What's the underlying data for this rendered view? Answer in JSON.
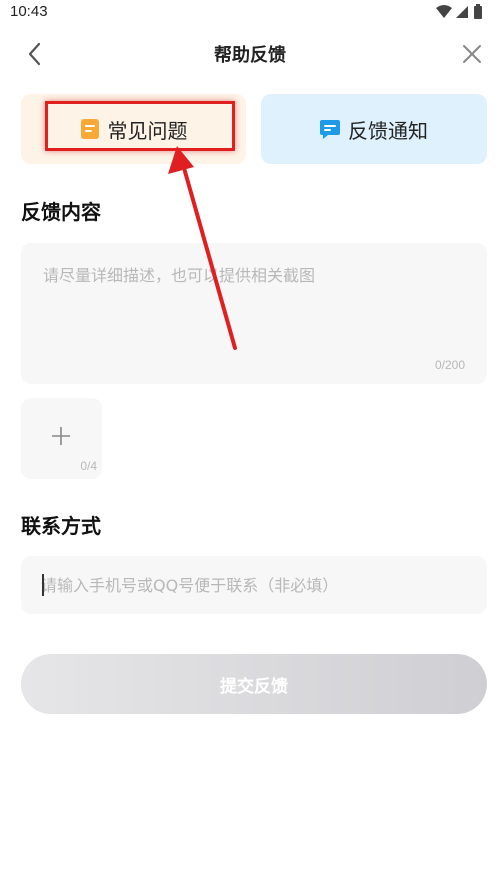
{
  "status_bar": {
    "time": "10:43"
  },
  "nav": {
    "title": "帮助反馈"
  },
  "tabs": [
    {
      "label": "常见问题",
      "icon": "note-icon",
      "color": "#f7a938",
      "background": "#fdf3e7"
    },
    {
      "label": "反馈通知",
      "icon": "message-icon",
      "color": "#1e9be8",
      "background": "#def1fc"
    }
  ],
  "feedback": {
    "title": "反馈内容",
    "placeholder": "请尽量详细描述，也可以提供相关截图",
    "count": "0/200"
  },
  "upload": {
    "count": "0/4"
  },
  "contact": {
    "title": "联系方式",
    "placeholder": "请输入手机号或QQ号便于联系（非必填）"
  },
  "submit": {
    "label": "提交反馈"
  },
  "colors": {
    "highlight": "#e02020",
    "arrow": "#e02020"
  }
}
